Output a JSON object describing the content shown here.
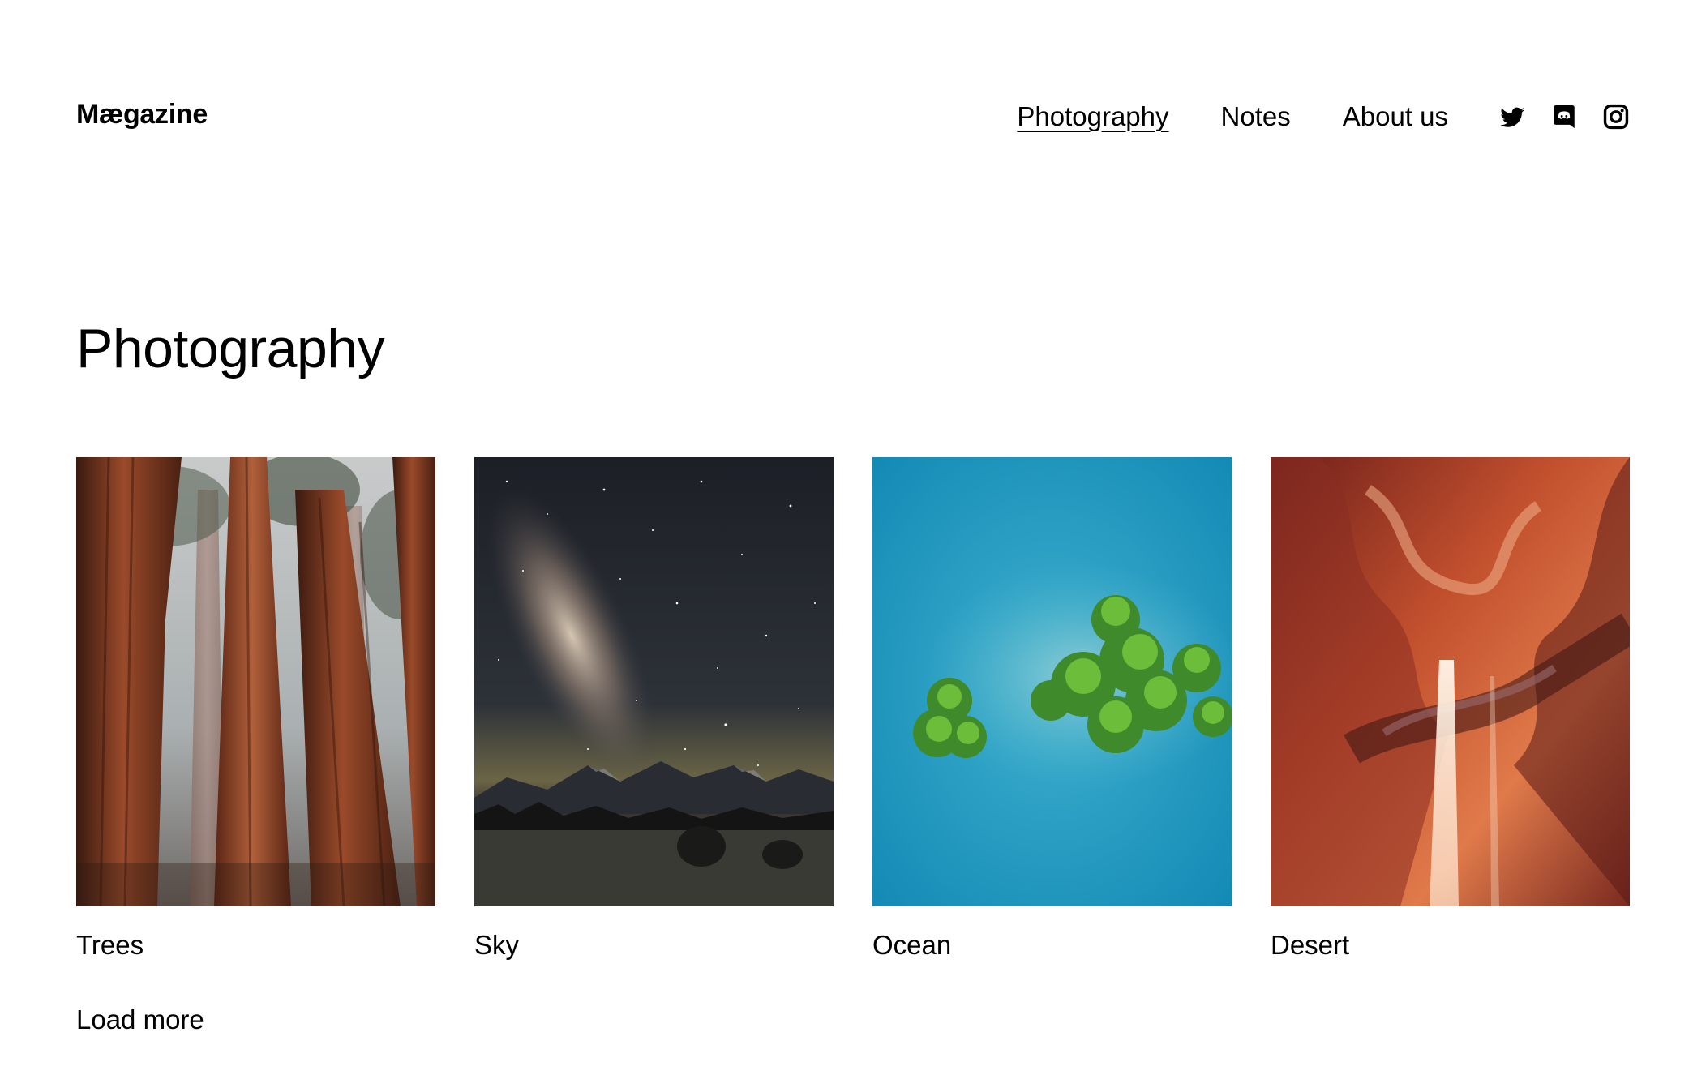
{
  "header": {
    "site_title": "Mægazine",
    "nav": [
      {
        "label": "Photography",
        "active": true
      },
      {
        "label": "Notes",
        "active": false
      },
      {
        "label": "About us",
        "active": false
      }
    ],
    "social": [
      "twitter-icon",
      "discord-icon",
      "instagram-icon"
    ]
  },
  "main": {
    "page_title": "Photography",
    "posts": [
      {
        "title": "Trees",
        "image": "redwood-trees-in-fog"
      },
      {
        "title": "Sky",
        "image": "milky-way-over-mountains"
      },
      {
        "title": "Ocean",
        "image": "aerial-island-in-turquoise-water"
      },
      {
        "title": "Desert",
        "image": "slot-canyon-light-beam"
      }
    ],
    "load_more_label": "Load more"
  },
  "colors": {
    "text": "#000000",
    "background": "#ffffff"
  }
}
